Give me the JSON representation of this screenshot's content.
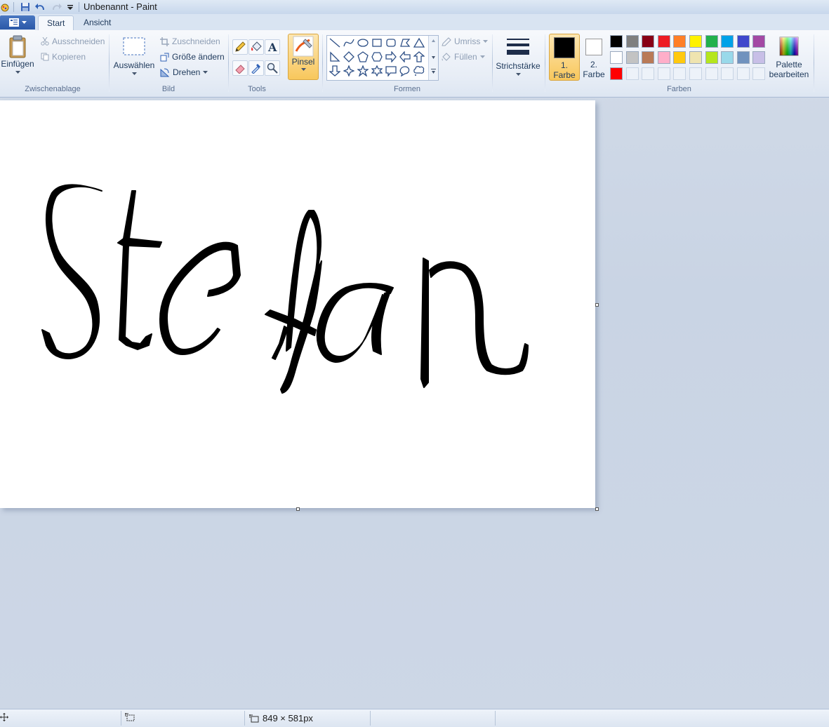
{
  "window": {
    "title": "Unbenannt - Paint"
  },
  "tabs": [
    {
      "label": "Start",
      "active": true
    },
    {
      "label": "Ansicht",
      "active": false
    }
  ],
  "clipboard": {
    "paste": "Einfügen",
    "cut": "Ausschneiden",
    "copy": "Kopieren",
    "group": "Zwischenablage"
  },
  "image": {
    "select": "Auswählen",
    "crop": "Zuschneiden",
    "resize": "Größe ändern",
    "rotate": "Drehen",
    "group": "Bild"
  },
  "tools": {
    "group": "Tools",
    "brush": "Pinsel"
  },
  "shapes": {
    "outline": "Umriss",
    "fill": "Füllen",
    "group": "Formen"
  },
  "stroke": {
    "label": "Strichstärke"
  },
  "colors": {
    "color1": "1.",
    "color1_sub": "Farbe",
    "color2": "2.",
    "color2_sub": "Farbe",
    "edit_palette_1": "Palette",
    "edit_palette_2": "bearbeiten",
    "group": "Farben",
    "color1_value": "#000000",
    "color2_value": "#ffffff",
    "palette_row1": [
      "#000000",
      "#7f7f7f",
      "#880015",
      "#ed1c24",
      "#ff7f27",
      "#fff200",
      "#22b14c",
      "#00a2e8",
      "#3f48cc",
      "#a349a4"
    ],
    "palette_row2": [
      "#ffffff",
      "#c3c3c3",
      "#b97a57",
      "#ffaec9",
      "#ffc90e",
      "#efe4b0",
      "#b5e61d",
      "#99d9ea",
      "#7092be",
      "#c8bfe7"
    ],
    "palette_row3": [
      "#ff0000",
      "",
      "",
      "",
      "",
      "",
      "",
      "",
      "",
      ""
    ]
  },
  "canvas": {
    "drawing_text": "Stefan"
  },
  "status": {
    "size": "849 × 581px"
  }
}
